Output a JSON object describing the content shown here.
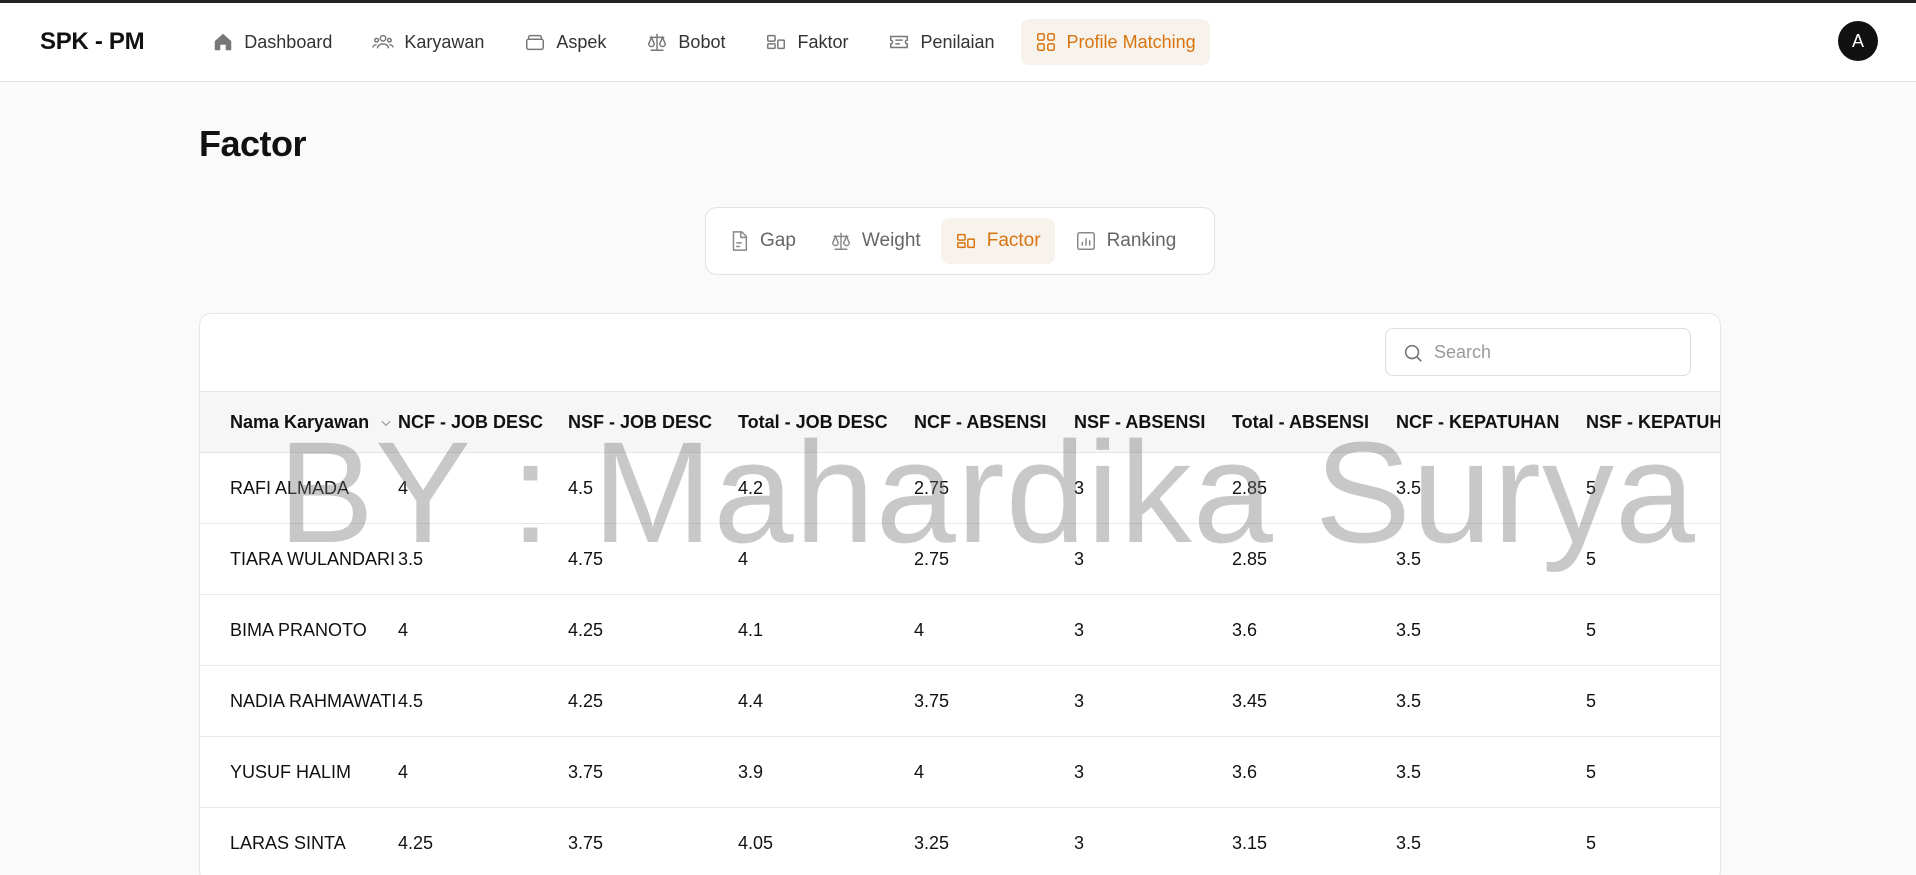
{
  "brand": "SPK - PM",
  "nav": [
    {
      "label": "Dashboard",
      "icon": "home-icon"
    },
    {
      "label": "Karyawan",
      "icon": "users-icon"
    },
    {
      "label": "Aspek",
      "icon": "layers-icon"
    },
    {
      "label": "Bobot",
      "icon": "scale-icon"
    },
    {
      "label": "Faktor",
      "icon": "factor-icon"
    },
    {
      "label": "Penilaian",
      "icon": "ticket-icon"
    },
    {
      "label": "Profile Matching",
      "icon": "grid-icon",
      "active": true
    }
  ],
  "avatar": "A",
  "page_title": "Factor",
  "subtabs": [
    {
      "label": "Gap",
      "icon": "file-icon"
    },
    {
      "label": "Weight",
      "icon": "scale-icon"
    },
    {
      "label": "Factor",
      "icon": "factor-icon",
      "active": true
    },
    {
      "label": "Ranking",
      "icon": "bar-chart-icon"
    }
  ],
  "search": {
    "placeholder": "Search"
  },
  "table": {
    "columns": [
      "Nama Karyawan",
      "NCF - JOB DESC",
      "NSF - JOB DESC",
      "Total - JOB DESC",
      "NCF - ABSENSI",
      "NSF - ABSENSI",
      "Total - ABSENSI",
      "NCF - KEPATUHAN",
      "NSF - KEPATUHAN"
    ],
    "rows": [
      [
        "RAFI ALMADA",
        "4",
        "4.5",
        "4.2",
        "2.75",
        "3",
        "2.85",
        "3.5",
        "5"
      ],
      [
        "TIARA WULANDARI",
        "3.5",
        "4.75",
        "4",
        "2.75",
        "3",
        "2.85",
        "3.5",
        "5"
      ],
      [
        "BIMA PRANOTO",
        "4",
        "4.25",
        "4.1",
        "4",
        "3",
        "3.6",
        "3.5",
        "5"
      ],
      [
        "NADIA RAHMAWATI",
        "4.5",
        "4.25",
        "4.4",
        "3.75",
        "3",
        "3.45",
        "3.5",
        "5"
      ],
      [
        "YUSUF HALIM",
        "4",
        "3.75",
        "3.9",
        "4",
        "3",
        "3.6",
        "3.5",
        "5"
      ],
      [
        "LARAS SINTA",
        "4.25",
        "3.75",
        "4.05",
        "3.25",
        "3",
        "3.15",
        "3.5",
        "5"
      ]
    ]
  },
  "watermark": "BY : Mahardika Surya",
  "colors": {
    "accent": "#d9730d",
    "active_bg": "#f7f3ec"
  }
}
